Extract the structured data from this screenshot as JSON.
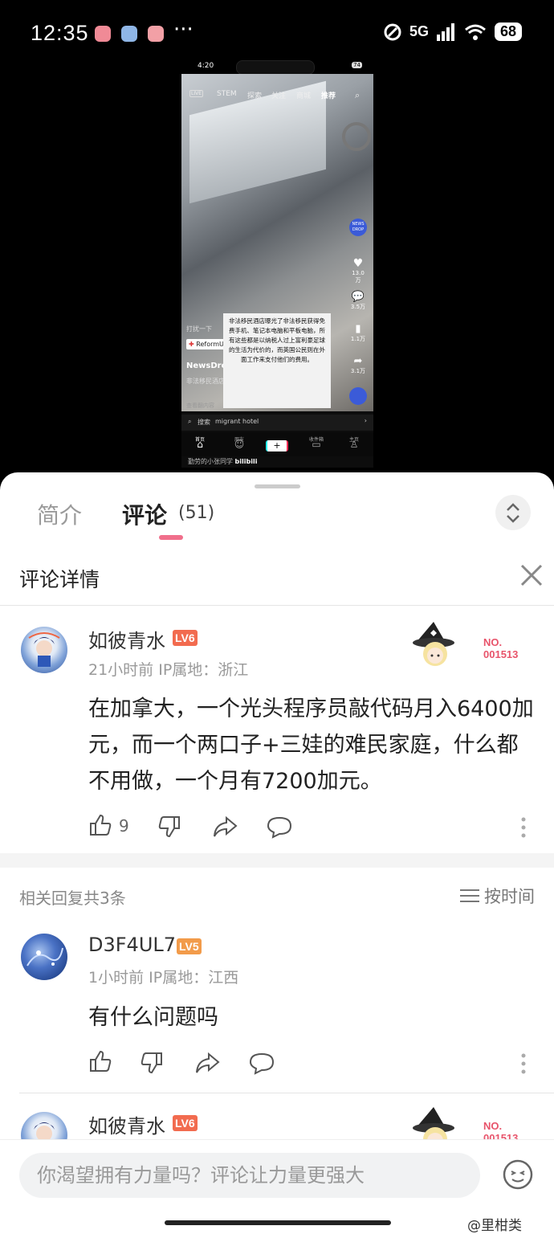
{
  "status_bar": {
    "time": "12:35",
    "dots": "···",
    "network": "5G",
    "battery": "68"
  },
  "video": {
    "time": "4:20",
    "battery": "74",
    "top_tabs": [
      "STEM",
      "探索",
      "关注",
      "商城",
      "推荐"
    ],
    "right_counts": {
      "like": "13.0万",
      "comment": "3.5万",
      "save": "1.1万",
      "share": "3.1万"
    },
    "news_logo": "NEWS DROP",
    "label_line": "打扰一下",
    "reform_tag": "ReformUK35 转发",
    "account": "NewsDrop",
    "desc_line": "非法移民酒店... 机、笔记本电脑... 日行... 展开",
    "desc_more": "查看翻内容",
    "subtitle": "非法移民酒店曝光了非法移民获得免费手机、笔记本电脑和平板电脑，所有这些都是以纳税人过上富利豪足球的生活为代价的，而英国公民则在外面工作来支付他们的费用。",
    "search_label": "搜索",
    "search_term": "migrant hotel",
    "nav": [
      "首页",
      "朋友",
      "+",
      "收件箱",
      "主页"
    ],
    "caption": "勤劳的小张同学",
    "watermark_logo": "bilibili"
  },
  "panel": {
    "tab_intro": "简介",
    "tab_comments": "评论",
    "comment_count": "(51)",
    "detail_title": "评论详情",
    "main_comment": {
      "username": "如彼青水",
      "level": "LV6",
      "meta": "21小时前  IP属地：浙江",
      "badge_line1": "NO.",
      "badge_line2": "001513",
      "text": "在加拿大，一个光头程序员敲代码月入6400加元，而一个两口子+三娃的难民家庭，什么都不用做，一个月有7200加元。",
      "likes": "9"
    },
    "replies_header": "相关回复共3条",
    "sort_label": "按时间",
    "reply1": {
      "username": "D3F4UL7",
      "level": "LV5",
      "meta": "1小时前  IP属地：江西",
      "text": "有什么问题吗"
    },
    "reply2": {
      "username": "如彼青水",
      "level": "LV6",
      "badge_line1": "NO.",
      "badge_line2": "001513"
    },
    "input_placeholder": "你渴望拥有力量吗？评论让力量更强大",
    "watermark": "@里柑类"
  },
  "colors": {
    "accent_pink": "#f06f8b",
    "lv6": "#f26b4f",
    "lv5": "#f29b4a",
    "badge_red": "#e8546b"
  }
}
